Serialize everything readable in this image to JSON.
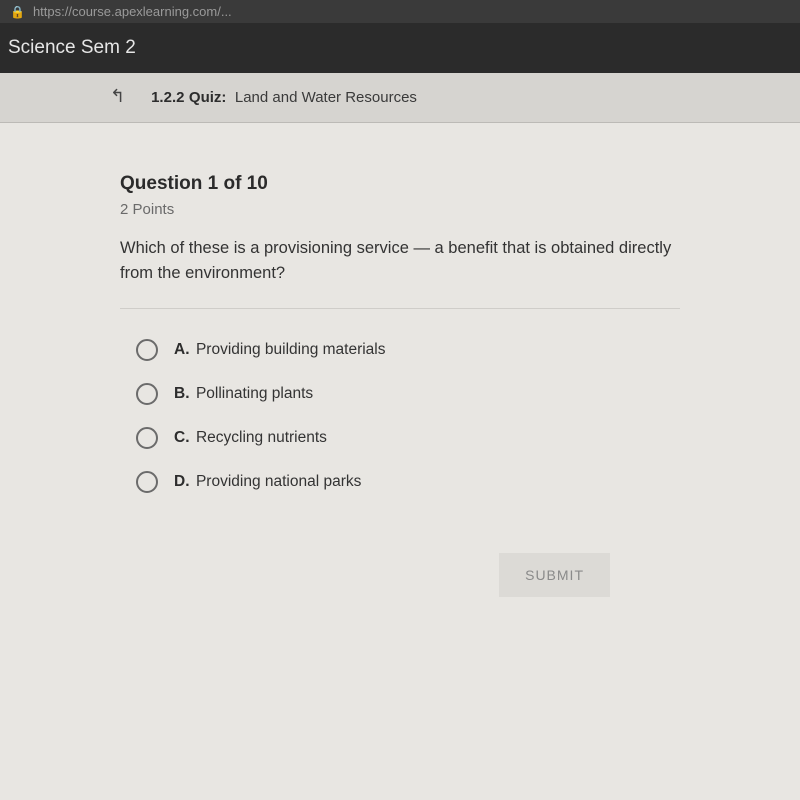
{
  "url_bar": {
    "text": "https://course.apexlearning.com/..."
  },
  "course_bar": {
    "title": "Science Sem 2"
  },
  "quiz_bar": {
    "number": "1.2.2",
    "label": "Quiz:",
    "title": "Land and Water Resources"
  },
  "question": {
    "heading": "Question 1 of 10",
    "points": "2 Points",
    "text": "Which of these is a provisioning service — a benefit that is obtained directly from the environment?"
  },
  "options": [
    {
      "letter": "A.",
      "text": "Providing building materials"
    },
    {
      "letter": "B.",
      "text": "Pollinating plants"
    },
    {
      "letter": "C.",
      "text": "Recycling nutrients"
    },
    {
      "letter": "D.",
      "text": "Providing national parks"
    }
  ],
  "submit": {
    "label": "SUBMIT"
  }
}
